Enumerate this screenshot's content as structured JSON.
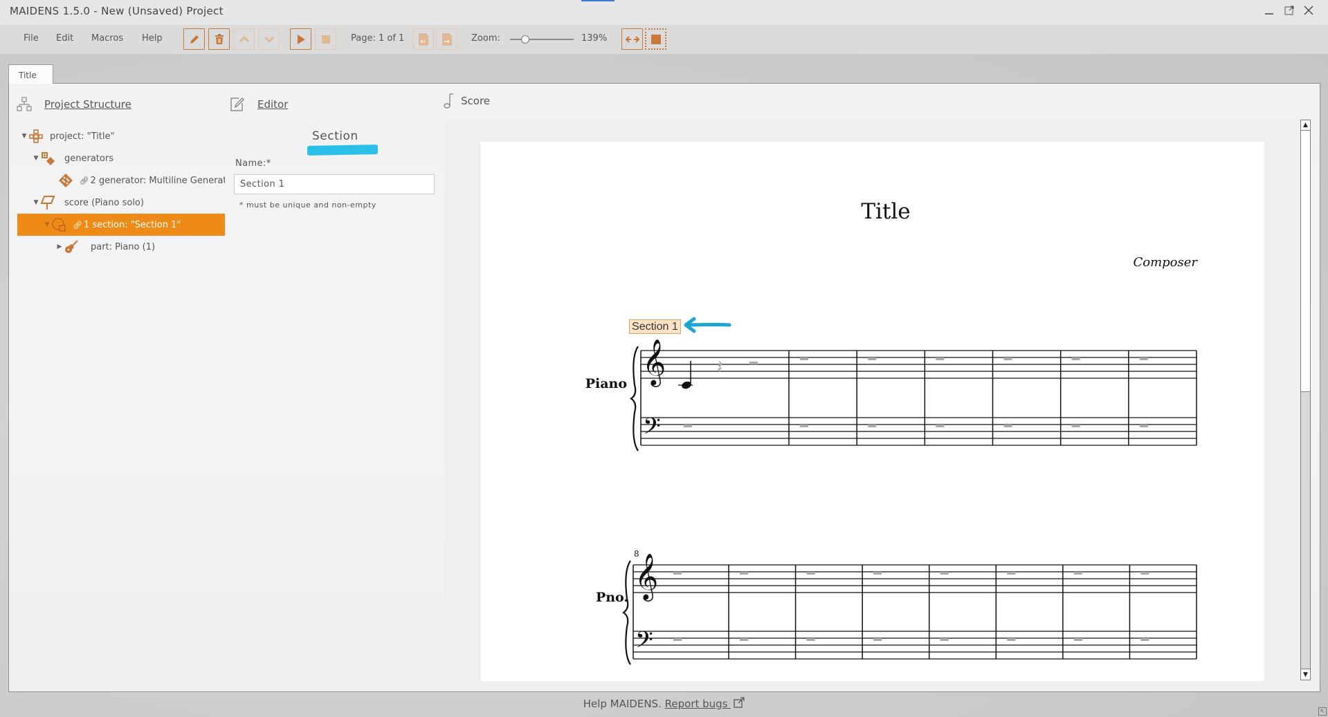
{
  "window": {
    "title": "MAIDENS 1.5.0 - New (Unsaved) Project",
    "controls": [
      "minimize",
      "popout",
      "close"
    ]
  },
  "menu": {
    "items": [
      "File",
      "Edit",
      "Macros",
      "Help"
    ]
  },
  "toolbar": {
    "buttons": [
      {
        "name": "edit",
        "icon": "pencil-icon",
        "enabled": true
      },
      {
        "name": "delete",
        "icon": "trash-icon",
        "enabled": true
      },
      {
        "name": "move-up",
        "icon": "chevron-up-icon",
        "enabled": false
      },
      {
        "name": "move-down",
        "icon": "chevron-down-icon",
        "enabled": false
      },
      {
        "name": "play",
        "icon": "play-icon",
        "enabled": true
      },
      {
        "name": "stop",
        "icon": "stop-icon",
        "enabled": false
      }
    ],
    "page_label": "Page: 1 of 1",
    "prev_page_icon": "page-prev-icon",
    "next_page_icon": "page-next-icon",
    "zoom_label": "Zoom:",
    "zoom_value": "139%",
    "zoom_slider_fraction": 0.2,
    "fit_width_icon": "fit-width-icon",
    "fit_page_icon": "fit-page-icon"
  },
  "tabs": [
    {
      "label": "Title",
      "active": true
    }
  ],
  "panels": {
    "structure": {
      "label": "Project Structure",
      "icon": "hierarchy-icon"
    },
    "editor": {
      "label": "Editor",
      "icon": "edit-icon"
    },
    "score": {
      "label": "Score",
      "icon": "music-note-icon"
    }
  },
  "tree": [
    {
      "label": "project: \"Title\"",
      "level": 0,
      "expanded": true,
      "icon": "project-icon",
      "selected": false
    },
    {
      "label": "generators",
      "level": 1,
      "expanded": true,
      "icon": "generators-icon",
      "selected": false
    },
    {
      "label": "2 generator: Multiline Generat",
      "level": 2,
      "expanded": null,
      "icon": "generator-icon",
      "linked": true,
      "selected": false
    },
    {
      "label": "score (Piano solo)",
      "level": 1,
      "expanded": true,
      "icon": "score-stand-icon",
      "selected": false
    },
    {
      "label": "1 section: \"Section 1\"",
      "level": 2,
      "expanded": true,
      "icon": "section-icon",
      "linked": true,
      "selected": true
    },
    {
      "label": "part: Piano (1)",
      "level": 3,
      "expanded": false,
      "icon": "guitar-icon",
      "selected": false
    }
  ],
  "editor": {
    "heading": "Section",
    "name_label": "Name:*",
    "name_value": "Section 1",
    "hint": "* must be unique and non-empty"
  },
  "score": {
    "title": "Title",
    "composer": "Composer",
    "section_label": "Section 1",
    "systems": [
      {
        "instrument": "Piano",
        "first_measure": 1,
        "measures": 7,
        "show_measure_number": false
      },
      {
        "instrument": "Pno.",
        "first_measure": 8,
        "measures": 8,
        "show_measure_number": true,
        "measure_number": "8"
      }
    ],
    "first_measure_content": "C4 quarter note, quarter rest, half rest"
  },
  "footer": {
    "text": "Help MAIDENS.",
    "link": "Report bugs",
    "link_icon": "external-link-icon"
  },
  "colors": {
    "accent": "#c8793a",
    "selection": "#ee8a16",
    "highlight": "#2bc0ea",
    "section_label_bg": "#fde3c6"
  }
}
